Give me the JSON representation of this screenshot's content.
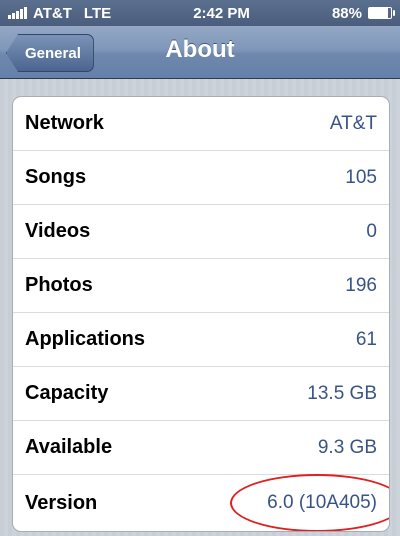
{
  "status_bar": {
    "carrier": "AT&T",
    "network": "LTE",
    "time": "2:42 PM",
    "battery_percent": "88%",
    "battery_level": 0.88
  },
  "nav": {
    "back_label": "General",
    "title": "About"
  },
  "rows": [
    {
      "label": "Network",
      "value": "AT&T"
    },
    {
      "label": "Songs",
      "value": "105"
    },
    {
      "label": "Videos",
      "value": "0"
    },
    {
      "label": "Photos",
      "value": "196"
    },
    {
      "label": "Applications",
      "value": "61"
    },
    {
      "label": "Capacity",
      "value": "13.5 GB"
    },
    {
      "label": "Available",
      "value": "9.3 GB"
    },
    {
      "label": "Version",
      "value": "6.0 (10A405)"
    }
  ],
  "colors": {
    "value_text": "#385487",
    "annotation": "#e02020"
  }
}
